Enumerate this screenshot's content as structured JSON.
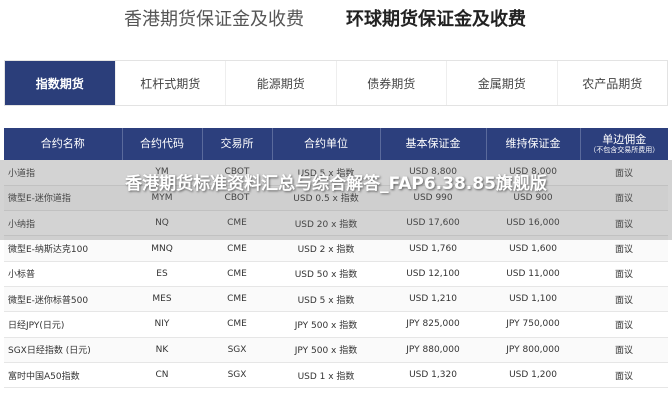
{
  "top_tabs": [
    {
      "label": "香港期货保证金及收费"
    },
    {
      "label": "环球期货保证金及收费"
    }
  ],
  "categories": [
    {
      "label": "指数期货"
    },
    {
      "label": "杠杆式期货"
    },
    {
      "label": "能源期货"
    },
    {
      "label": "债券期货"
    },
    {
      "label": "金属期货"
    },
    {
      "label": "农产品期货"
    }
  ],
  "table": {
    "headers": [
      "合约名称",
      "合约代码",
      "交易所",
      "合约单位",
      "基本保证金",
      "维持保证金",
      "单边佣金"
    ],
    "header_note": "（不包含交易所费用）",
    "rows": [
      [
        "小道指",
        "YM",
        "CBOT",
        "USD 5 x 指数",
        "USD 8,800",
        "USD 8,000",
        "面议"
      ],
      [
        "微型E-迷你道指",
        "MYM",
        "CBOT",
        "USD 0.5 x 指数",
        "USD 990",
        "USD 900",
        "面议"
      ],
      [
        "小纳指",
        "NQ",
        "CME",
        "USD 20 x 指数",
        "USD 17,600",
        "USD 16,000",
        "面议"
      ],
      [
        "微型E-纳斯达克100",
        "MNQ",
        "CME",
        "USD 2 x 指数",
        "USD 1,760",
        "USD 1,600",
        "面议"
      ],
      [
        "小标普",
        "ES",
        "CME",
        "USD 50 x 指数",
        "USD 12,100",
        "USD 11,000",
        "面议"
      ],
      [
        "微型E-迷你标普500",
        "MES",
        "CME",
        "USD 5 x 指数",
        "USD 1,210",
        "USD 1,100",
        "面议"
      ],
      [
        "日经JPY(日元)",
        "NIY",
        "CME",
        "JPY 500 x 指数",
        "JPY 825,000",
        "JPY 750,000",
        "面议"
      ],
      [
        "SGX日经指数 (日元)",
        "NK",
        "SGX",
        "JPY 500 x 指数",
        "JPY 880,000",
        "JPY 800,000",
        "面议"
      ],
      [
        "富时中国A50指数",
        "CN",
        "SGX",
        "USD 1 x 指数",
        "USD 1,320",
        "USD 1,200",
        "面议"
      ]
    ]
  },
  "overlay_title": "香港期货标准资料汇总与综合解答_FAP6.38.85旗舰版"
}
